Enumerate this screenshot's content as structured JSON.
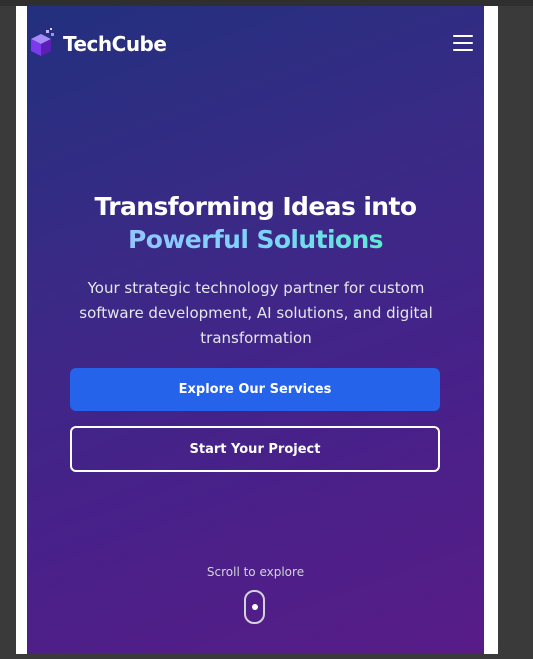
{
  "brand": {
    "name": "TechCube",
    "icon": "cube-logo-icon",
    "accent": "#8b5cf6"
  },
  "nav": {
    "menu_icon": "hamburger-menu-icon"
  },
  "hero": {
    "headline_line1": "Transforming Ideas into",
    "headline_line2": "Powerful Solutions",
    "subtitle": "Your strategic technology partner for custom software development, AI solutions, and digital transformation",
    "primary_cta": "Explore Our Services",
    "secondary_cta": "Start Your Project",
    "scroll_hint": "Scroll to explore",
    "scroll_icon": "mouse-scroll-icon"
  },
  "colors": {
    "primary_button": "#2563eb",
    "gradient_start": "#22307e",
    "gradient_end": "#581c87",
    "highlight_start": "#93c5fd",
    "highlight_end": "#5eead4"
  }
}
